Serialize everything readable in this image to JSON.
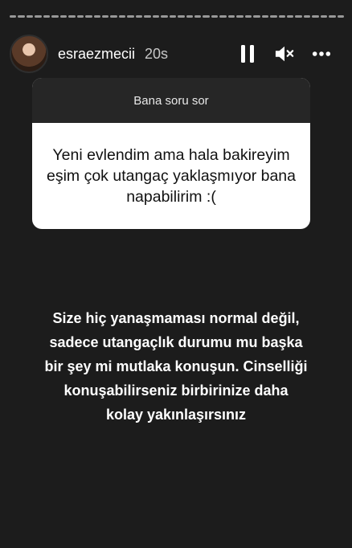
{
  "story": {
    "username": "esraezmecii",
    "time": "20s",
    "icons": {
      "pause": "pause-icon",
      "mute": "mute-icon",
      "more": "more-icon"
    }
  },
  "question_box": {
    "header": "Bana soru sor",
    "question": "Yeni evlendim ama hala bakireyim eşim çok utangaç yaklaşmıyor bana napabilirim :("
  },
  "answer": {
    "text": "Size hiç yanaşmaması normal değil,\nsadece utangaçlık durumu  mu başka\nbir şey mi mutlaka konuşun. Cinselliği\nkonuşabilirseniz birbirinize daha\nkolay yakınlaşırsınız"
  },
  "colors": {
    "background": "#1c1c1c",
    "question_header": "#262626",
    "question_body": "#ffffff"
  }
}
